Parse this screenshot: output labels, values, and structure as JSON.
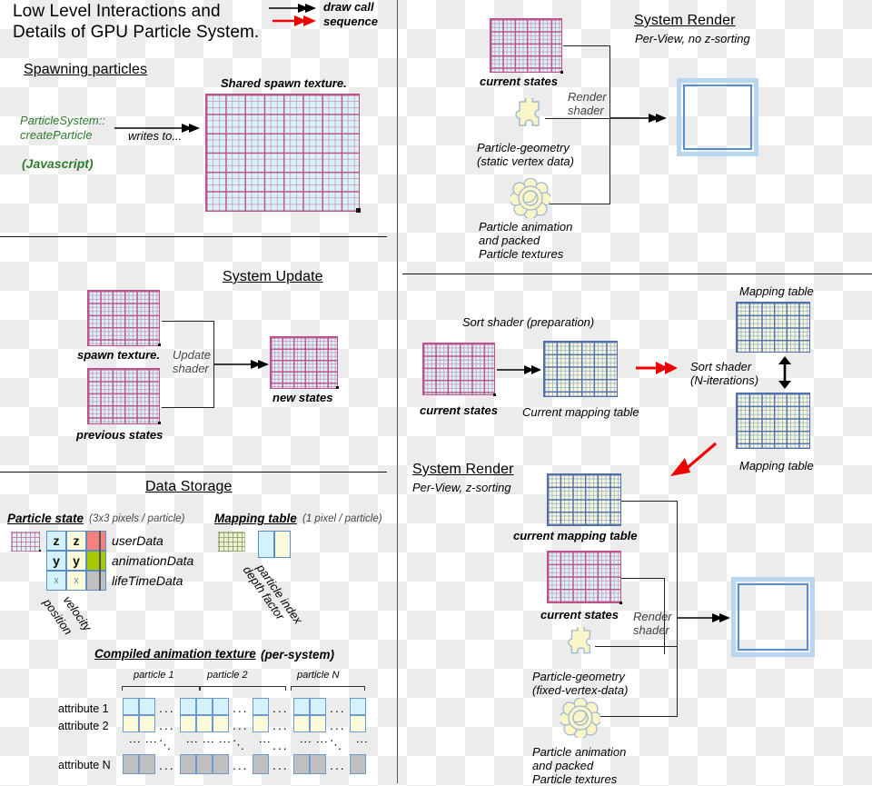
{
  "header": {
    "title_line1": "Low Level Interactions and",
    "title_line2": "Details of GPU Particle System.",
    "legend": [
      {
        "label": "draw call",
        "color": "#000000",
        "icon": "black-arrow-icon"
      },
      {
        "label": "sequence",
        "color": "#ee0000",
        "icon": "red-arrow-icon"
      }
    ]
  },
  "spawning": {
    "section_title": "Spawning particles",
    "texture_label": "Shared spawn texture.",
    "source_line1": "ParticleSystem::",
    "source_line2": "createParticle",
    "source_lang": "(Javascript)",
    "source_color": "#2f7a2f",
    "edge_label": "writes to..."
  },
  "system_update": {
    "section_title": "System Update",
    "input_top_label": "spawn texture.",
    "input_bottom_label": "previous states",
    "shader_line1": "Update",
    "shader_line2": "shader",
    "output_label": "new states"
  },
  "data_storage": {
    "section_title": "Data Storage",
    "particle_state": {
      "title": "Particle state",
      "subtitle": "(3x3 pixels / particle)",
      "grid": [
        [
          "z",
          "z",
          ""
        ],
        [
          "y",
          "y",
          ""
        ],
        [
          "x",
          "x",
          ""
        ]
      ],
      "row_labels": [
        "userData",
        "animationData",
        "lifeTimeData"
      ],
      "column_labels": [
        "position",
        "velocity"
      ],
      "colors": {
        "position": "#d4f2fb",
        "velocity": "#fbfbd9",
        "userData": "#f48080",
        "animationData": "#a8c800",
        "lifeTimeData": "#bfbfbf"
      }
    },
    "mapping_table": {
      "title": "Mapping table",
      "subtitle": "(1 pixel / particle)",
      "column_labels": [
        "particle index",
        "depth factor"
      ],
      "colors": {
        "particle_index": "#d4f2fb",
        "depth_factor": "#fbfbd9"
      }
    },
    "compiled_animation": {
      "title": "Compiled animation texture",
      "subtitle": "(per-system)",
      "group_labels": [
        "particle 1",
        "particle 2",
        "particle N"
      ],
      "row_labels": [
        "attribute 1",
        "attribute 2",
        "attribute N"
      ],
      "row_colors": [
        "#d4f2fb",
        "#fbfbd9",
        "#bfbfbf"
      ],
      "ellipsis": "..."
    }
  },
  "system_render_top": {
    "section_title": "System Render",
    "subtitle": "Per-View, no z-sorting",
    "input_label": "current states",
    "shader_line1": "Render",
    "shader_line2": "shader",
    "geometry_label_line1": "Particle-geometry",
    "geometry_label_line2": "(static vertex data)",
    "animation_label_line1": "Particle animation",
    "animation_label_line2": "and packed",
    "animation_label_line3": "Particle textures",
    "geometry_icon": "puzzle-piece-icon",
    "animation_icon": "gear-flower-icon",
    "output_icon": "screen-frame-icon"
  },
  "sort": {
    "prep_label": "Sort shader (preparation)",
    "input_label": "current states",
    "output_label": "Current mapping table",
    "iter_line1": "Sort shader",
    "iter_line2": "(N-iterations)",
    "map_label_top": "Mapping table",
    "map_label_bottom": "Mapping table"
  },
  "system_render_bottom": {
    "section_title": "System Render",
    "subtitle": "Per-View, z-sorting",
    "mapping_label": "current mapping table",
    "states_label": "current states",
    "shader_line1": "Render",
    "shader_line2": "shader",
    "geometry_label_line1": "Particle-geometry",
    "geometry_label_line2": "(fixed-vertex-data)",
    "animation_label_line1": "Particle animation",
    "animation_label_line2": "and packed",
    "animation_label_line3": "Particle textures",
    "geometry_icon": "puzzle-piece-icon",
    "animation_icon": "gear-flower-icon",
    "output_icon": "screen-frame-icon"
  }
}
